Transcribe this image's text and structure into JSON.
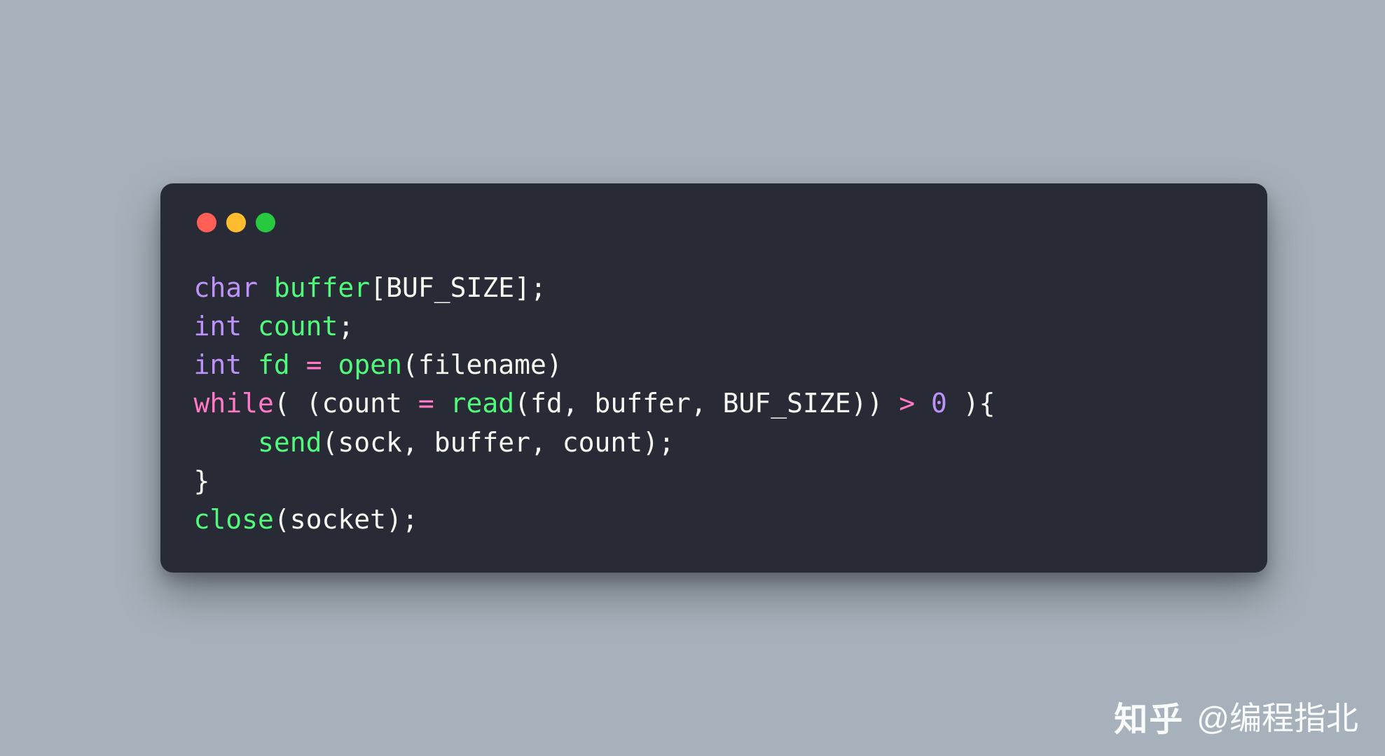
{
  "colors": {
    "background": "#a7b1bb",
    "window_bg": "#282a36",
    "traffic_red": "#ff5f56",
    "traffic_yellow": "#ffbd2e",
    "traffic_green": "#27c93f",
    "text_default": "#f8f8f2",
    "text_type": "#bd93f9",
    "text_keyword": "#ff79c6",
    "text_function": "#50fa7b",
    "text_number": "#bd93f9"
  },
  "code": {
    "line1": {
      "t1": "char",
      "t2": " ",
      "t3": "buffer",
      "t4": "[",
      "t5": "BUF_SIZE",
      "t6": "];"
    },
    "line2": {
      "t1": "int",
      "t2": " ",
      "t3": "count",
      "t4": ";"
    },
    "line3": {
      "t1": "int",
      "t2": " ",
      "t3": "fd",
      "t4": " ",
      "t5": "=",
      "t6": " ",
      "t7": "open",
      "t8": "(",
      "t9": "filename",
      "t10": ")"
    },
    "line4": {
      "t1": "while",
      "t2": "( (",
      "t3": "count",
      "t4": " ",
      "t5": "=",
      "t6": " ",
      "t7": "read",
      "t8": "(",
      "t9": "fd",
      "t10": ", ",
      "t11": "buffer",
      "t12": ", ",
      "t13": "BUF_SIZE",
      "t14": ")) ",
      "t15": ">",
      "t16": " ",
      "t17": "0",
      "t18": " ){"
    },
    "line5": {
      "t1": "    ",
      "t2": "send",
      "t3": "(",
      "t4": "sock",
      "t5": ", ",
      "t6": "buffer",
      "t7": ", ",
      "t8": "count",
      "t9": ");"
    },
    "line6": {
      "t1": "}"
    },
    "line7": {
      "t1": "close",
      "t2": "(",
      "t3": "socket",
      "t4": ");"
    }
  },
  "watermark": {
    "logo": "知乎",
    "text": "@编程指北"
  }
}
